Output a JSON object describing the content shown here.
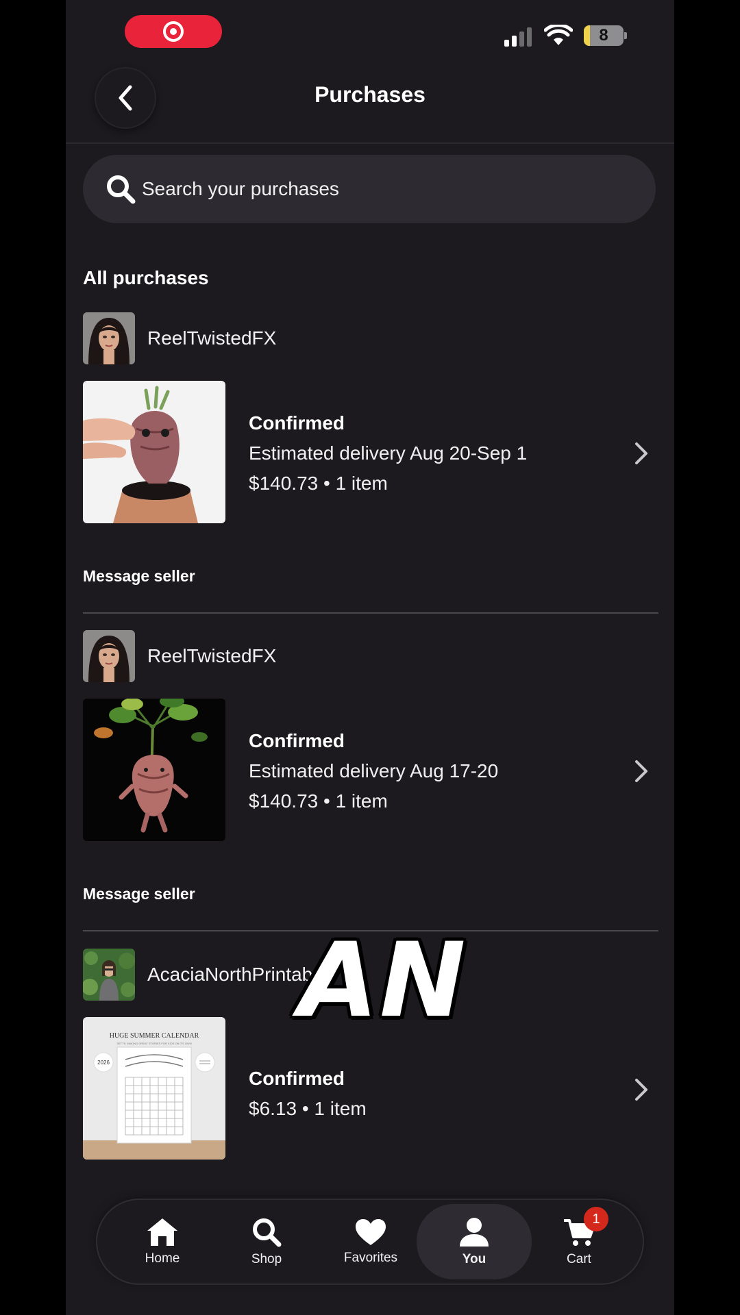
{
  "status_bar": {
    "battery_level": "8"
  },
  "header": {
    "title": "Purchases"
  },
  "search": {
    "placeholder": "Search your purchases"
  },
  "section_title": "All purchases",
  "purchases": [
    {
      "seller": "ReelTwistedFX",
      "status": "Confirmed",
      "delivery": "Estimated delivery Aug 20-Sep 1",
      "price_items": "$140.73 • 1 item",
      "message_label": "Message seller"
    },
    {
      "seller": "ReelTwistedFX",
      "status": "Confirmed",
      "delivery": "Estimated delivery Aug 17-20",
      "price_items": "$140.73 • 1 item",
      "message_label": "Message seller"
    },
    {
      "seller": "AcaciaNorthPrintab",
      "status": "Confirmed",
      "price_items": "$6.13 • 1 item",
      "thumb_text": {
        "title": "HUGE SUMMER CALENDAR",
        "subtitle": "SETTS: MAKING GREAT STORIES FOR KIDS ON ITS OWN",
        "year": "2026"
      }
    }
  ],
  "overlay_caption": "AN",
  "nav": {
    "items": [
      {
        "label": "Home",
        "icon": "home-icon"
      },
      {
        "label": "Shop",
        "icon": "search-icon"
      },
      {
        "label": "Favorites",
        "icon": "heart-icon"
      },
      {
        "label": "You",
        "icon": "person-icon",
        "active": true
      },
      {
        "label": "Cart",
        "icon": "cart-icon"
      }
    ],
    "cart_badge": "1"
  },
  "colors": {
    "background": "#1c1a1f",
    "search_bg": "#2d2b31",
    "record_pill": "#e8233a",
    "badge": "#d4281c"
  }
}
